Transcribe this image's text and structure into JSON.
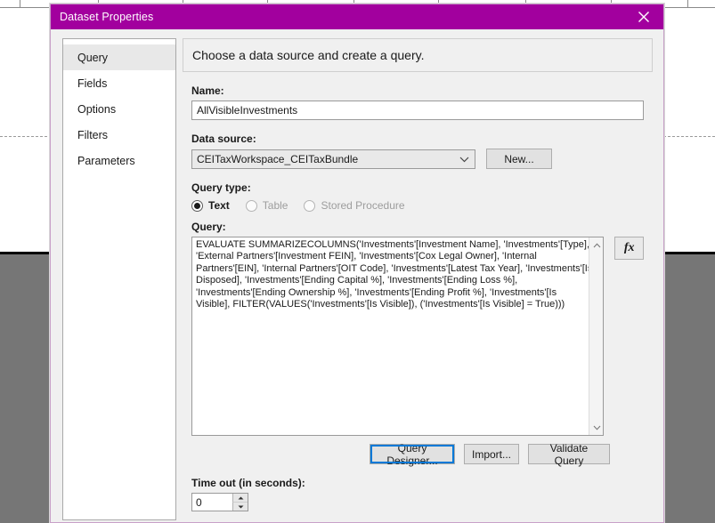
{
  "dialog": {
    "title": "Dataset Properties",
    "close_icon": "close-icon"
  },
  "sidebar": {
    "items": [
      {
        "label": "Query",
        "selected": true
      },
      {
        "label": "Fields",
        "selected": false
      },
      {
        "label": "Options",
        "selected": false
      },
      {
        "label": "Filters",
        "selected": false
      },
      {
        "label": "Parameters",
        "selected": false
      }
    ]
  },
  "pane": {
    "header": "Choose a data source and create a query.",
    "name": {
      "label": "Name:",
      "value": "AllVisibleInvestments"
    },
    "data_source": {
      "label": "Data source:",
      "value": "CEITaxWorkspace_CEITaxBundle",
      "chevron_icon": "chevron-down-icon",
      "new_button": "New..."
    },
    "query_type": {
      "label": "Query type:",
      "options": [
        {
          "label": "Text",
          "selected": true,
          "disabled": false
        },
        {
          "label": "Table",
          "selected": false,
          "disabled": true
        },
        {
          "label": "Stored Procedure",
          "selected": false,
          "disabled": true
        }
      ]
    },
    "query": {
      "label": "Query:",
      "text": "EVALUATE SUMMARIZECOLUMNS('Investments'[Investment Name], 'Investments'[Type], 'External Partners'[Investment FEIN], 'Investments'[Cox Legal Owner], 'Internal Partners'[EIN], 'Internal Partners'[OIT Code], 'Investments'[Latest Tax Year], 'Investments'[Is Disposed], 'Investments'[Ending Capital %], 'Investments'[Ending Loss %], 'Investments'[Ending Ownership %], 'Investments'[Ending Profit %], 'Investments'[Is Visible], FILTER(VALUES('Investments'[Is Visible]), ('Investments'[Is Visible] = True)))",
      "expression_button": "fx",
      "scroll_up_icon": "chevron-up-icon",
      "scroll_down_icon": "chevron-down-icon"
    },
    "actions": {
      "query_designer": "Query Designer...",
      "import": "Import...",
      "validate": "Validate Query"
    },
    "timeout": {
      "label": "Time out (in seconds):",
      "value": "0",
      "up_icon": "spinner-up-icon",
      "down_icon": "spinner-down-icon"
    }
  },
  "colors": {
    "titlebar": "#a2009e",
    "focus_outline": "#0078d7",
    "workspace": "#767676"
  }
}
